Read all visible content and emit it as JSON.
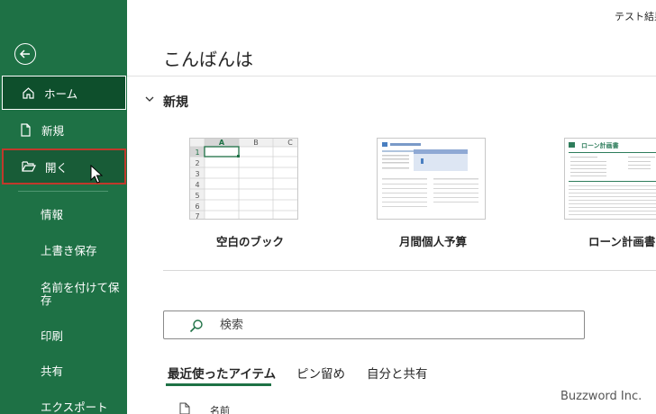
{
  "window": {
    "title": "テスト結果"
  },
  "sidebar": {
    "home_label": "ホーム",
    "new_label": "新規",
    "open_label": "開く",
    "sub_items": [
      "情報",
      "上書き保存",
      "名前を付けて保存",
      "印刷",
      "共有",
      "エクスポート"
    ]
  },
  "main": {
    "greeting": "こんばんは",
    "new_section": "新規",
    "templates": [
      {
        "label": "空白のブック"
      },
      {
        "label": "月間個人予算"
      },
      {
        "label": "ローン計画書"
      }
    ],
    "blank_sheet": {
      "cols": [
        "A",
        "B",
        "C"
      ],
      "rows": [
        "1",
        "2",
        "3",
        "4",
        "5",
        "6",
        "7"
      ]
    },
    "loan_title": "ローン計画書"
  },
  "search": {
    "placeholder": "検索"
  },
  "tabs": [
    "最近使ったアイテム",
    "ピン留め",
    "自分と共有"
  ],
  "list": {
    "name_header": "名前"
  },
  "watermark": "Buzzword Inc.",
  "colors": {
    "sidebar": "#1e7145",
    "accent": "#1e7145",
    "highlight_border": "#c0392b"
  }
}
